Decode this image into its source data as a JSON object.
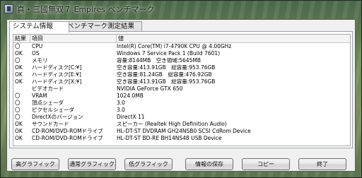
{
  "window": {
    "title": "真・三國無双７ Empires ベンチマーク"
  },
  "tabs": [
    {
      "label": "システム情報"
    },
    {
      "label": "ベンチマーク測定結果"
    }
  ],
  "table": {
    "columns": [
      "結果",
      "項目",
      "値"
    ],
    "rows": [
      {
        "result": "〇",
        "item": "CPU",
        "value": "Intel(R) Core(TM) i7-4790K CPU @ 4.00GHz"
      },
      {
        "result": "OK",
        "item": "OS",
        "value": "Windows 7 Service Pack 1 (Build 7601)"
      },
      {
        "result": "〇",
        "item": "メモリ",
        "value": "容量:8144MB　空き領域:5645MB"
      },
      {
        "result": "OK",
        "item": "ハードディスク[C:¥]",
        "value": "空き容量:413.91GB　総容量:953.76GB"
      },
      {
        "result": "OK",
        "item": "ハードディスク[E:¥]",
        "value": "空き容量:81.24GB　総容量:476.92GB"
      },
      {
        "result": "OK",
        "item": "ハードディスク[X:¥]",
        "value": "空き容量:413.91GB　総容量:953.76GB"
      },
      {
        "result": "",
        "item": "ビデオカード",
        "value": "NVIDIA GeForce GTX 650"
      },
      {
        "result": "〇",
        "item": "VRAM",
        "value": "1024.0MB"
      },
      {
        "result": "〇",
        "item": "頂点シェーダ",
        "value": "3.0"
      },
      {
        "result": "〇",
        "item": "ピクセルシェーダ",
        "value": "3.0"
      },
      {
        "result": "〇",
        "item": "DirectXのバージョン",
        "value": "DirectX 11"
      },
      {
        "result": "OK",
        "item": "サウンドカード",
        "value": "スピーカー (Realtek High Definition Audio)"
      },
      {
        "result": "OK",
        "item": "CD-ROM/DVD-ROMドライブ",
        "value": "HL-DT-ST DVDRAM GH24NSB0 SCSI CdRom Device"
      },
      {
        "result": "OK",
        "item": "CD-ROM/DVD-ROMドライブ",
        "value": "HL-DT-ST BD-RE  BH14NS48 USB Device"
      }
    ]
  },
  "buttons": {
    "high": "高グラフィック",
    "normal": "通常グラフィック",
    "low": "低グラフィック",
    "save": "情報の保存",
    "copy": "コピー",
    "exit": "終了"
  }
}
